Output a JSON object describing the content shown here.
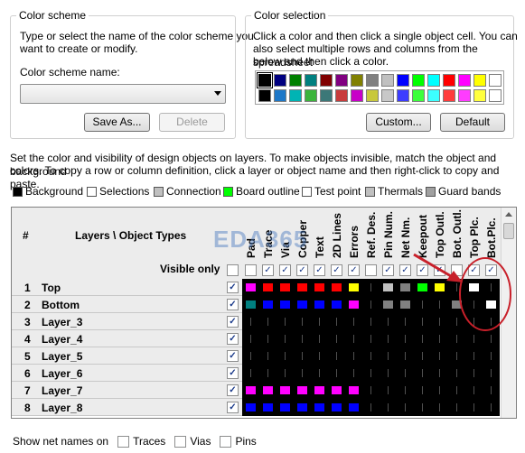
{
  "scheme": {
    "title": "Color scheme",
    "desc1": "Type or select the name of the color scheme you",
    "desc2": "want to create or modify.",
    "name_label": "Color scheme name:",
    "name_value": "",
    "save_label": "Save As...",
    "delete_label": "Delete"
  },
  "selection": {
    "title": "Color selection",
    "desc1": "Click a color and then click a single object cell. You can",
    "desc2": "also select multiple rows and columns from the spreadsheet",
    "desc3": "below and then click a color.",
    "custom_label": "Custom...",
    "default_label": "Default",
    "palette_row1": [
      "#000000",
      "#000080",
      "#008000",
      "#008080",
      "#800000",
      "#800080",
      "#808000",
      "#808080",
      "#c0c0c0",
      "#0000ff",
      "#00ff00",
      "#00ffff",
      "#ff0000",
      "#ff00ff",
      "#ffff00",
      "#ffffff"
    ],
    "palette_row2": [
      "#000000",
      "#1e78c8",
      "#00b4b4",
      "#3cb43c",
      "#3c7878",
      "#c83c3c",
      "#c800c8",
      "#c8c83c",
      "#c8c8c8",
      "#3c3cff",
      "#3cff3c",
      "#3cffff",
      "#ff3c3c",
      "#ff3cff",
      "#ffff3c",
      "#ffffff"
    ]
  },
  "instructions": {
    "line1": "Set the color and visibility of design objects on layers. To make objects invisible, match the object and background",
    "line2": "colors. To copy a row or column definition, click a layer or object name and then right-click to copy and paste."
  },
  "legend": [
    {
      "label": "Background",
      "color": "#000000"
    },
    {
      "label": "Selections",
      "color": "#ffffff"
    },
    {
      "label": "Connection",
      "color": "#c0c0c0"
    },
    {
      "label": "Board outline",
      "color": "#00ff00"
    },
    {
      "label": "Test point",
      "color": "#ffffff"
    },
    {
      "label": "Thermals",
      "color": "#c0c0c0"
    },
    {
      "label": "Guard bands",
      "color": "#a0a0a0"
    }
  ],
  "grid": {
    "hash": "#",
    "layers_header": "Layers \\ Object Types",
    "visible_only": "Visible only",
    "columns": [
      "Pad",
      "Trace",
      "Via",
      "Copper",
      "Text",
      "2D Lines",
      "Errors",
      "Ref. Des.",
      "Pin Num.",
      "Net Nm.",
      "Keepout",
      "Top Outl.",
      "Bot. Outl.",
      "Top Plc.",
      "Bot.Plc."
    ],
    "column_visible": [
      false,
      true,
      true,
      true,
      true,
      true,
      true,
      false,
      true,
      true,
      true,
      true,
      false,
      true,
      true
    ],
    "rows": [
      {
        "num": "1",
        "name": "Top",
        "visible": true,
        "colors": [
          "#ff00ff",
          "#ff0000",
          "#ff0000",
          "#ff0000",
          "#ff0000",
          "#ff0000",
          "#ffff00",
          "#000000",
          "#c0c0c0",
          "#808080",
          "#00ff00",
          "#ffff00",
          "#000000",
          "#ffffff",
          "#000000"
        ]
      },
      {
        "num": "2",
        "name": "Bottom",
        "visible": true,
        "colors": [
          "#008080",
          "#0000ff",
          "#0000ff",
          "#0000ff",
          "#0000ff",
          "#0000ff",
          "#ff00ff",
          "#000000",
          "#808080",
          "#808080",
          "#000000",
          "#000000",
          "#808080",
          "#000000",
          "#ffffff"
        ]
      },
      {
        "num": "3",
        "name": "Layer_3",
        "visible": true,
        "colors": [
          "#000000",
          "#000000",
          "#000000",
          "#000000",
          "#000000",
          "#000000",
          "#000000",
          "#000000",
          "#000000",
          "#000000",
          "#000000",
          "#000000",
          "#000000",
          "#000000",
          "#000000"
        ]
      },
      {
        "num": "4",
        "name": "Layer_4",
        "visible": true,
        "colors": [
          "#000000",
          "#000000",
          "#000000",
          "#000000",
          "#000000",
          "#000000",
          "#000000",
          "#000000",
          "#000000",
          "#000000",
          "#000000",
          "#000000",
          "#000000",
          "#000000",
          "#000000"
        ]
      },
      {
        "num": "5",
        "name": "Layer_5",
        "visible": true,
        "colors": [
          "#000000",
          "#000000",
          "#000000",
          "#000000",
          "#000000",
          "#000000",
          "#000000",
          "#000000",
          "#000000",
          "#000000",
          "#000000",
          "#000000",
          "#000000",
          "#000000",
          "#000000"
        ]
      },
      {
        "num": "6",
        "name": "Layer_6",
        "visible": true,
        "colors": [
          "#000000",
          "#000000",
          "#000000",
          "#000000",
          "#000000",
          "#000000",
          "#000000",
          "#000000",
          "#000000",
          "#000000",
          "#000000",
          "#000000",
          "#000000",
          "#000000",
          "#000000"
        ]
      },
      {
        "num": "7",
        "name": "Layer_7",
        "visible": true,
        "colors": [
          "#ff00ff",
          "#ff00ff",
          "#ff00ff",
          "#ff00ff",
          "#ff00ff",
          "#ff00ff",
          "#ff00ff",
          "#000000",
          "#000000",
          "#000000",
          "#000000",
          "#000000",
          "#000000",
          "#000000",
          "#000000"
        ]
      },
      {
        "num": "8",
        "name": "Layer_8",
        "visible": true,
        "colors": [
          "#0000ff",
          "#0000ff",
          "#0000ff",
          "#0000ff",
          "#0000ff",
          "#0000ff",
          "#0000ff",
          "#000000",
          "#000000",
          "#000000",
          "#000000",
          "#000000",
          "#000000",
          "#000000",
          "#000000"
        ]
      }
    ]
  },
  "watermark": "EDA365",
  "net_names": {
    "label": "Show net names on",
    "options": [
      {
        "label": "Traces",
        "checked": false
      },
      {
        "label": "Vias",
        "checked": false
      },
      {
        "label": "Pins",
        "checked": false
      }
    ]
  }
}
